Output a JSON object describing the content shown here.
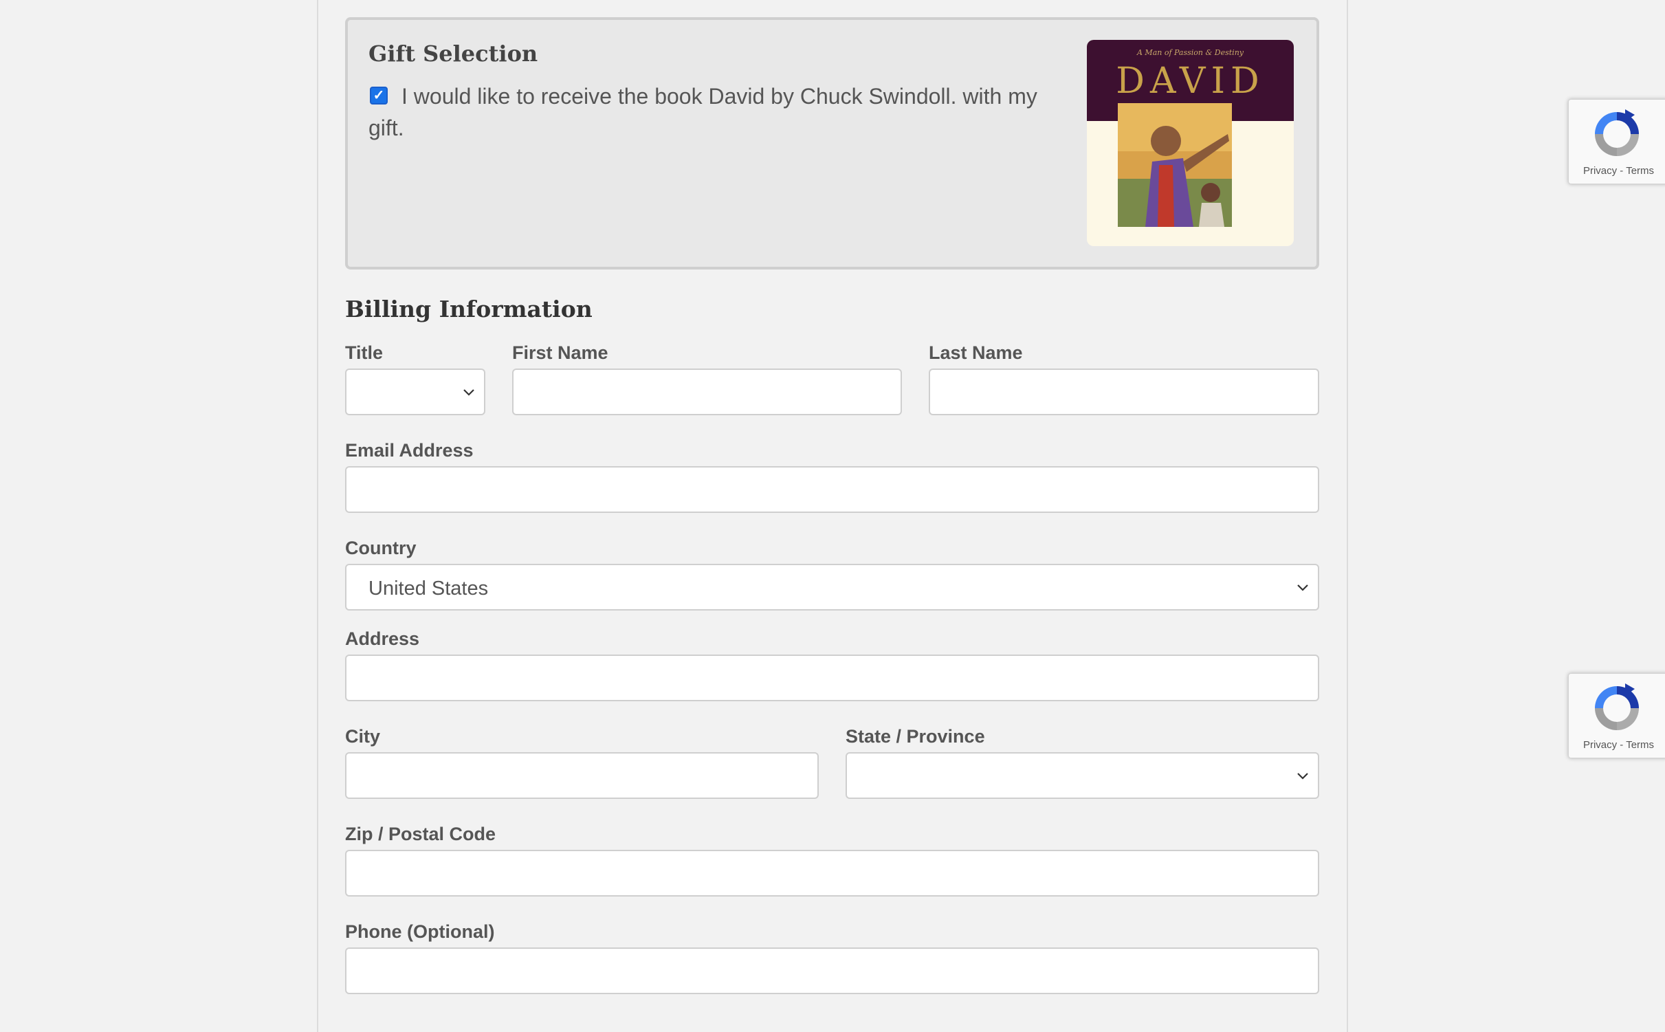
{
  "gift": {
    "title": "Gift Selection",
    "checkbox_checked": true,
    "text": "I would like to receive the book David by Chuck Swindoll. with my gift.",
    "book_cover": {
      "tagline": "A Man of Passion & Destiny",
      "title": "DAVID"
    }
  },
  "billing": {
    "title": "Billing Information",
    "title_label": "Title",
    "first_name_label": "First Name",
    "last_name_label": "Last Name",
    "email_label": "Email Address",
    "country_label": "Country",
    "country_value": "United States",
    "address_label": "Address",
    "city_label": "City",
    "state_label": "State / Province",
    "zip_label": "Zip / Postal Code",
    "phone_label": "Phone (Optional)"
  },
  "recaptcha": {
    "privacy": "Privacy",
    "separator": " - ",
    "terms": "Terms"
  },
  "colors": {
    "checkbox": "#1a73e8",
    "book_band": "#3d1030",
    "book_gold": "#c9a24a"
  }
}
